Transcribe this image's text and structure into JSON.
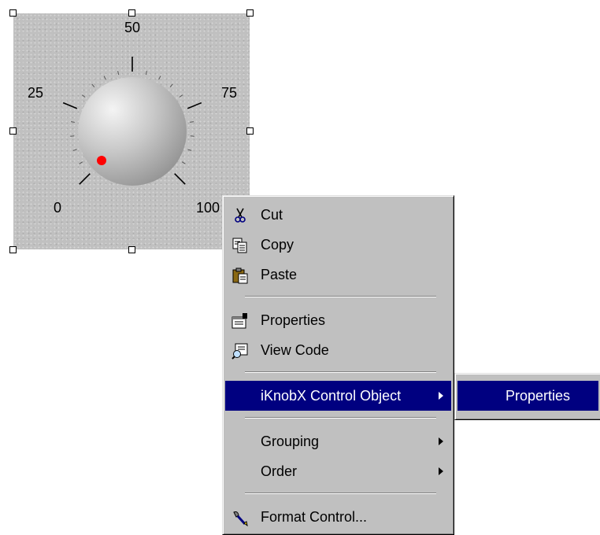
{
  "knob": {
    "scale_labels": [
      "0",
      "25",
      "50",
      "75",
      "100"
    ],
    "indicator_color": "#ff0000"
  },
  "context_menu": {
    "items": [
      {
        "label": "Cut",
        "icon": "scissors-icon"
      },
      {
        "label": "Copy",
        "icon": "copy-icon"
      },
      {
        "label": "Paste",
        "icon": "paste-icon"
      },
      {
        "label": "Properties",
        "icon": "properties-icon"
      },
      {
        "label": "View Code",
        "icon": "view-code-icon"
      },
      {
        "label": "iKnobX Control Object",
        "has_submenu": true,
        "highlighted": true
      },
      {
        "label": "Grouping",
        "has_submenu": true
      },
      {
        "label": "Order",
        "has_submenu": true
      },
      {
        "label": "Format Control...",
        "icon": "format-control-icon"
      }
    ]
  },
  "submenu": {
    "items": [
      {
        "label": "Properties",
        "highlighted": true
      }
    ]
  },
  "colors": {
    "menu_background": "#c0c0c0",
    "highlight": "#000080",
    "highlight_text": "#ffffff"
  }
}
